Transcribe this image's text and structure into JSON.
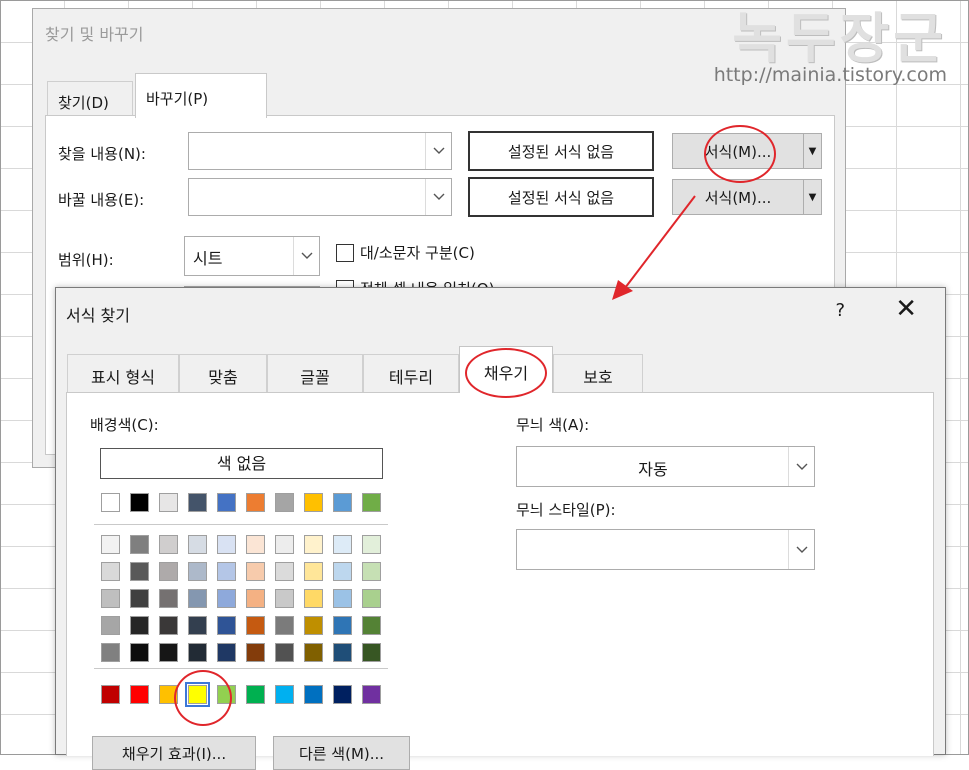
{
  "watermark": {
    "title": "녹두장군",
    "url": "http://mainia.tistory.com"
  },
  "find_replace": {
    "title": "찾기 및 바꾸기",
    "tabs": [
      {
        "label": "찾기(D)"
      },
      {
        "label": "바꾸기(P)"
      }
    ],
    "find_label": "찾을 내용(N):",
    "replace_label": "바꿀 내용(E):",
    "find_format_preview": "설정된 서식 없음",
    "replace_format_preview": "설정된 서식 없음",
    "format_button_1": "서식(M)...",
    "format_button_2": "서식(M)...",
    "scope_label": "범위(H):",
    "scope_value": "시트",
    "match_case": "대/소문자 구분(C)",
    "match_entire": "전체 셀 내용 일치(O)"
  },
  "format_find": {
    "title": "서식 찾기",
    "help": "?",
    "close": "✕",
    "tabs": [
      {
        "label": "표시 형식"
      },
      {
        "label": "맞춤"
      },
      {
        "label": "글꼴"
      },
      {
        "label": "테두리"
      },
      {
        "label": "채우기"
      },
      {
        "label": "보호"
      }
    ],
    "active_tab": "채우기",
    "bg_color_label": "배경색(C):",
    "no_color": "색 없음",
    "pattern_color_label": "무늬 색(A):",
    "pattern_color_value": "자동",
    "pattern_style_label": "무늬 스타일(P):",
    "pattern_style_value": "",
    "fill_effects_button": "채우기 효과(I)...",
    "more_colors_button": "다른 색(M)...",
    "theme_colors_top": [
      "#FFFFFF",
      "#000000",
      "#E7E6E6",
      "#44546A",
      "#4472C4",
      "#ED7D31",
      "#A5A5A5",
      "#FFC000",
      "#5B9BD5",
      "#70AD47"
    ],
    "theme_tints": [
      [
        "#F2F2F2",
        "#7F7F7F",
        "#D0CECE",
        "#D6DCE4",
        "#D9E2F3",
        "#FBE5D5",
        "#EDEDED",
        "#FFF2CC",
        "#DDEBF7",
        "#E2EFDA"
      ],
      [
        "#D9D9D9",
        "#595959",
        "#AEAAAA",
        "#ADB9CA",
        "#B4C6E7",
        "#F7CBAC",
        "#DBDBDB",
        "#FFE699",
        "#BDD7EE",
        "#C6E0B4"
      ],
      [
        "#BFBFBF",
        "#404040",
        "#757171",
        "#8497B0",
        "#8EA9DB",
        "#F4B183",
        "#C9C9C9",
        "#FFD966",
        "#9BC2E6",
        "#A9D08E"
      ],
      [
        "#A6A6A6",
        "#262626",
        "#3A3838",
        "#333F4F",
        "#2F5496",
        "#C55A11",
        "#7B7B7B",
        "#BF8F00",
        "#2F75B5",
        "#548235"
      ],
      [
        "#808080",
        "#0D0D0D",
        "#161616",
        "#222B35",
        "#1F3864",
        "#833C0B",
        "#525252",
        "#806000",
        "#1F4E78",
        "#375623"
      ]
    ],
    "standard_colors": [
      "#C00000",
      "#FF0000",
      "#FFC000",
      "#FFFF00",
      "#92D050",
      "#00B050",
      "#00B0F0",
      "#0070C0",
      "#002060",
      "#7030A0"
    ]
  }
}
